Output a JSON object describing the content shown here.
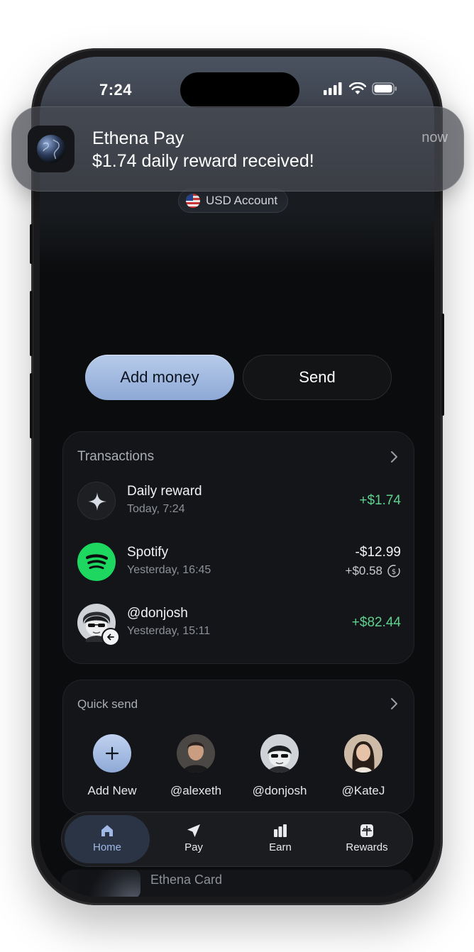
{
  "status_bar": {
    "time": "7:24"
  },
  "notification": {
    "app_name": "Ethena Pay",
    "message": "$1.74 daily reward received!",
    "time": "now",
    "icon": "globe-icon"
  },
  "account": {
    "label": "USD Account",
    "flag": "us-flag-icon"
  },
  "actions": {
    "add_money": "Add money",
    "send": "Send"
  },
  "transactions": {
    "title": "Transactions",
    "items": [
      {
        "name": "Daily reward",
        "sub": "Today, 7:24",
        "amount": "+$1.74",
        "icon": "sparkle-icon"
      },
      {
        "name": "Spotify",
        "sub": "Yesterday, 16:45",
        "amount": "-$12.99",
        "cashback": "+$0.58",
        "icon": "spotify-icon"
      },
      {
        "name": "@donjosh",
        "sub": "Yesterday, 15:11",
        "amount": "+$82.44",
        "icon": "avatar-donjosh"
      }
    ]
  },
  "quick_send": {
    "title": "Quick send",
    "items": [
      {
        "label": "Add New",
        "icon": "plus-icon"
      },
      {
        "label": "@alexeth",
        "icon": "avatar-alexeth"
      },
      {
        "label": "@donjosh",
        "icon": "avatar-donjosh"
      },
      {
        "label": "@KateJ",
        "icon": "avatar-katej"
      }
    ]
  },
  "tabs": [
    {
      "label": "Home",
      "icon": "home-icon",
      "active": true
    },
    {
      "label": "Pay",
      "icon": "send-arrow-icon"
    },
    {
      "label": "Earn",
      "icon": "bar-chart-icon"
    },
    {
      "label": "Rewards",
      "icon": "gift-icon"
    }
  ],
  "card_peek": {
    "label": "Ethena Card"
  },
  "colors": {
    "accent": "#9fb8e6",
    "positive": "#5ed18f",
    "background": "#0b0c0e"
  }
}
